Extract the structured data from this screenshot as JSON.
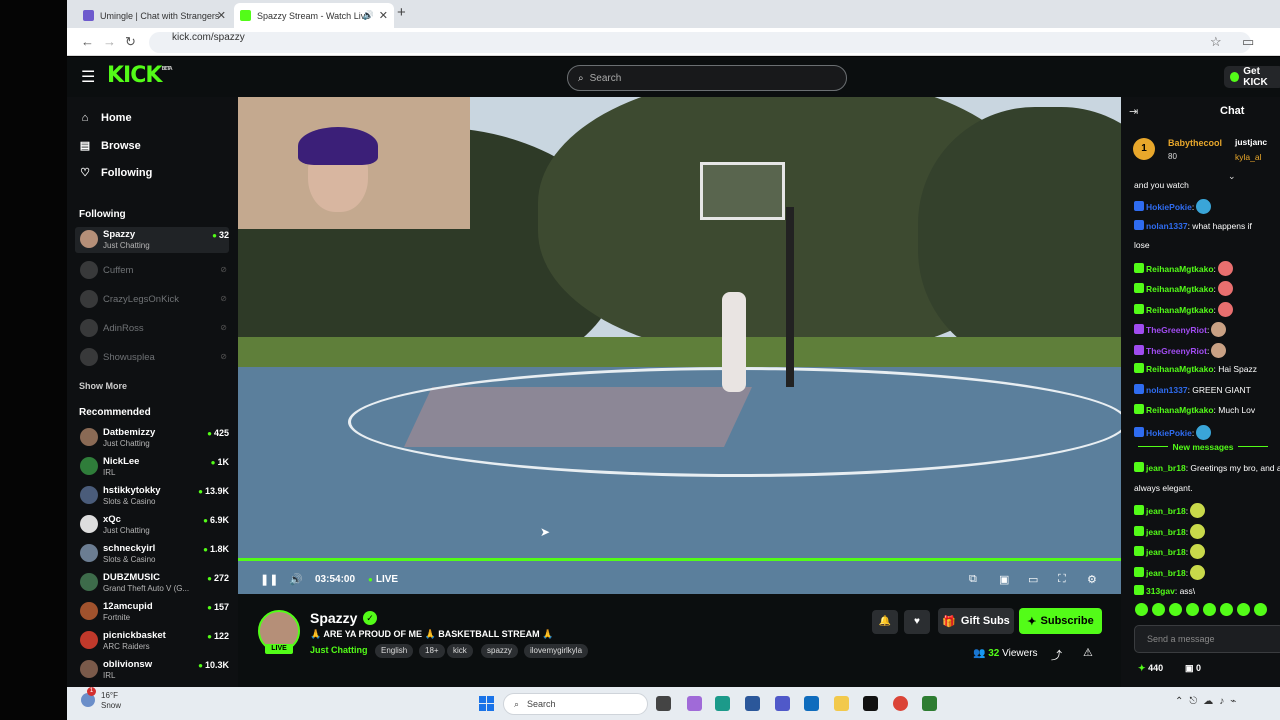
{
  "browser": {
    "tabs": [
      {
        "label": "Umingle | Chat with Strangers",
        "favicon_color": "#6e5acd"
      },
      {
        "label": "Spazzy Stream - Watch Live",
        "favicon_color": "#53fc18",
        "active": true
      }
    ],
    "url": "kick.com/spazzy"
  },
  "header": {
    "logo": "KICK",
    "logo_sup": "BETA",
    "search_placeholder": "Search",
    "get_kick_label": "Get KICK"
  },
  "sidebar": {
    "nav": [
      {
        "label": "Home",
        "icon": "home-icon"
      },
      {
        "label": "Browse",
        "icon": "browse-icon"
      },
      {
        "label": "Following",
        "icon": "heart-icon"
      }
    ],
    "following_title": "Following",
    "following": [
      {
        "name": "Spazzy",
        "category": "Just Chatting",
        "viewers": "32",
        "live": true
      },
      {
        "name": "Cuffem",
        "live": false
      },
      {
        "name": "CrazyLegsOnKick",
        "live": false
      },
      {
        "name": "AdinRoss",
        "live": false
      },
      {
        "name": "Showusplea",
        "live": false
      }
    ],
    "show_more": "Show More",
    "recommended_title": "Recommended",
    "recommended": [
      {
        "name": "Datbemizzy",
        "category": "Just Chatting",
        "viewers": "425"
      },
      {
        "name": "NickLee",
        "category": "IRL",
        "viewers": "1K"
      },
      {
        "name": "hstikkytokky",
        "category": "Slots & Casino",
        "viewers": "13.9K"
      },
      {
        "name": "xQc",
        "category": "Just Chatting",
        "viewers": "6.9K"
      },
      {
        "name": "schneckyirl",
        "category": "Slots & Casino",
        "viewers": "1.8K"
      },
      {
        "name": "DUBZMUSIC",
        "category": "Grand Theft Auto V (G...",
        "viewers": "272"
      },
      {
        "name": "12amcupid",
        "category": "Fortnite",
        "viewers": "157"
      },
      {
        "name": "picnickbasket",
        "category": "ARC Raiders",
        "viewers": "122"
      },
      {
        "name": "oblivionsw",
        "category": "IRL",
        "viewers": "10.3K"
      }
    ]
  },
  "player": {
    "time": "03:54:00",
    "live_label": "LIVE",
    "progress": 1.0
  },
  "stream": {
    "streamer": "Spazzy",
    "live_badge": "LIVE",
    "title": "🙏 ARE YA PROUD OF ME 🙏 BASKETBALL STREAM 🙏",
    "category": "Just Chatting",
    "tags": [
      "English",
      "18+",
      "kick",
      "spazzy",
      "ilovemygirlkyla"
    ],
    "gift_label": "Gift Subs",
    "subscribe_label": "Subscribe",
    "viewers_count": "32",
    "viewers_label": "Viewers"
  },
  "chat": {
    "title": "Chat",
    "pinned": {
      "name": "Babythecool",
      "sub": "80",
      "right1": "justjanc",
      "right2": "kyla_al"
    },
    "top_line": "and you watch",
    "messages": [
      {
        "user": "HokiePokie",
        "color": "#2f6cf0",
        "text": ":",
        "emote": "#3aa5d8"
      },
      {
        "user": "nolan1337",
        "color": "#2f6cf0",
        "text": ": what happens if",
        "emote": ""
      },
      {
        "user": "",
        "color": "#ffffff",
        "text": "lose",
        "emote": ""
      },
      {
        "user": "ReihanaMgtkako",
        "color": "#53fc18",
        "text": ":",
        "emote": "#e86f6f"
      },
      {
        "user": "ReihanaMgtkako",
        "color": "#53fc18",
        "text": ":",
        "emote": "#e86f6f"
      },
      {
        "user": "ReihanaMgtkako",
        "color": "#53fc18",
        "text": ":",
        "emote": "#e86f6f"
      },
      {
        "user": "TheGreenyRiot",
        "color": "#a04cf0",
        "text": ":",
        "emote": "#c9a184"
      },
      {
        "user": "TheGreenyRiot",
        "color": "#a04cf0",
        "text": ":",
        "emote": "#c9a184"
      },
      {
        "user": "ReihanaMgtkako",
        "color": "#53fc18",
        "text": ": Hai Spazz",
        "emote": ""
      },
      {
        "user": "nolan1337",
        "color": "#2f6cf0",
        "text": ": GREEN GIANT",
        "emote": ""
      },
      {
        "user": "ReihanaMgtkako",
        "color": "#53fc18",
        "text": ": Much Lov",
        "emote": ""
      },
      {
        "user": "HokiePokie",
        "color": "#2f6cf0",
        "text": ":",
        "emote": "#3aa5d8"
      }
    ],
    "new_messages_label": "New messages",
    "new_messages": [
      {
        "user": "jean_br18",
        "color": "#53fc18",
        "text": ": Greetings my bro, and al",
        "emote": ""
      },
      {
        "user": "",
        "color": "#ffffff",
        "text": "always elegant.",
        "emote": ""
      },
      {
        "user": "jean_br18",
        "color": "#53fc18",
        "text": ":",
        "emote": "#c8d94a"
      },
      {
        "user": "jean_br18",
        "color": "#53fc18",
        "text": ":",
        "emote": "#c8d94a"
      },
      {
        "user": "jean_br18",
        "color": "#53fc18",
        "text": ":",
        "emote": "#c8d94a"
      },
      {
        "user": "jean_br18",
        "color": "#53fc18",
        "text": ":",
        "emote": "#c8d94a"
      },
      {
        "user": "313gav",
        "color": "#53fc18",
        "text": ": ass\\",
        "emote": ""
      }
    ],
    "send_placeholder": "Send a message",
    "points": "440",
    "points2": "0"
  },
  "taskbar": {
    "weather_temp": "16°F",
    "weather_desc": "Snow",
    "weather_badge": "1",
    "search_label": "Search"
  },
  "colors": {
    "accent": "#53fc18",
    "bg": "#0b0e0f"
  }
}
